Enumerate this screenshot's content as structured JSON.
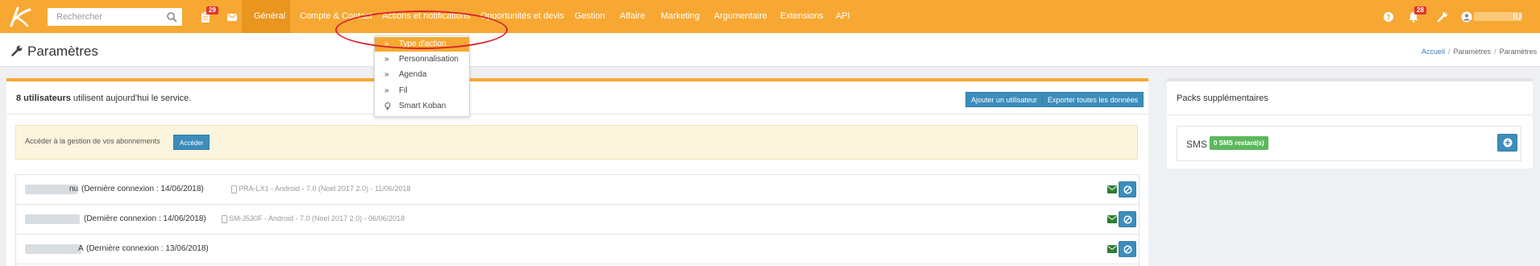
{
  "topbar": {
    "search_placeholder": "Rechercher",
    "tasks_badge": "29",
    "notifications_badge": "28",
    "user_name": "IU",
    "menu": [
      {
        "label": "Général",
        "active": true
      },
      {
        "label": "Compte & Contact"
      },
      {
        "label": "Actions et notifications"
      },
      {
        "label": "Opportunités et devis"
      },
      {
        "label": "Gestion"
      },
      {
        "label": "Affaire"
      },
      {
        "label": "Marketing"
      },
      {
        "label": "Argumentaire"
      },
      {
        "label": "Extensions"
      },
      {
        "label": "API"
      }
    ]
  },
  "dropdown": {
    "items": [
      {
        "label": "Type d'action",
        "icon": "double-chevron-right-icon",
        "selected": true
      },
      {
        "label": "Personnalisation",
        "icon": "double-chevron-right-icon"
      },
      {
        "label": "Agenda",
        "icon": "double-chevron-right-icon"
      },
      {
        "label": "Fil",
        "icon": "double-chevron-right-icon"
      },
      {
        "label": "Smart Koban",
        "icon": "lightbulb-icon"
      }
    ]
  },
  "page": {
    "title": "Paramètres",
    "breadcrumb": [
      "Accueil",
      "Paramètres",
      "Paramètres"
    ]
  },
  "main": {
    "users_count": "8 utilisateurs",
    "users_suffix": " utilisent aujourd'hui le service.",
    "add_user_button": "Ajouter un utilisateur",
    "export_button": "Exporter toutes les données",
    "alert_text": "Accéder à la gestion de vos abonnements",
    "alert_button": "Accéder",
    "users": [
      {
        "name_tail": "nu",
        "connection": "(Dernière connexion : 14/06/2018)",
        "device": "PRA-LX1 - Android - 7.0 (Noel 2017 2.0) - 11/06/2018"
      },
      {
        "name_tail": "",
        "connection": "(Dernière connexion : 14/06/2018)",
        "device": "SM-J530F - Android - 7.0 (Noel 2017 2.0) - 06/06/2018"
      },
      {
        "name_tail": "A",
        "connection": "(Dernière connexion : 13/06/2018)",
        "device": ""
      }
    ]
  },
  "side": {
    "title": "Packs supplémentaires",
    "sms_label": "SMS",
    "sms_badge": "0 SMS restant(s)"
  },
  "colors": {
    "brand_orange": "#f7a833",
    "active_menu": "#e9951e",
    "primary_button": "#3c8dbc",
    "success_badge": "#5cb85c",
    "danger_badge": "#e0342b",
    "annotation_red": "#d9232d"
  }
}
